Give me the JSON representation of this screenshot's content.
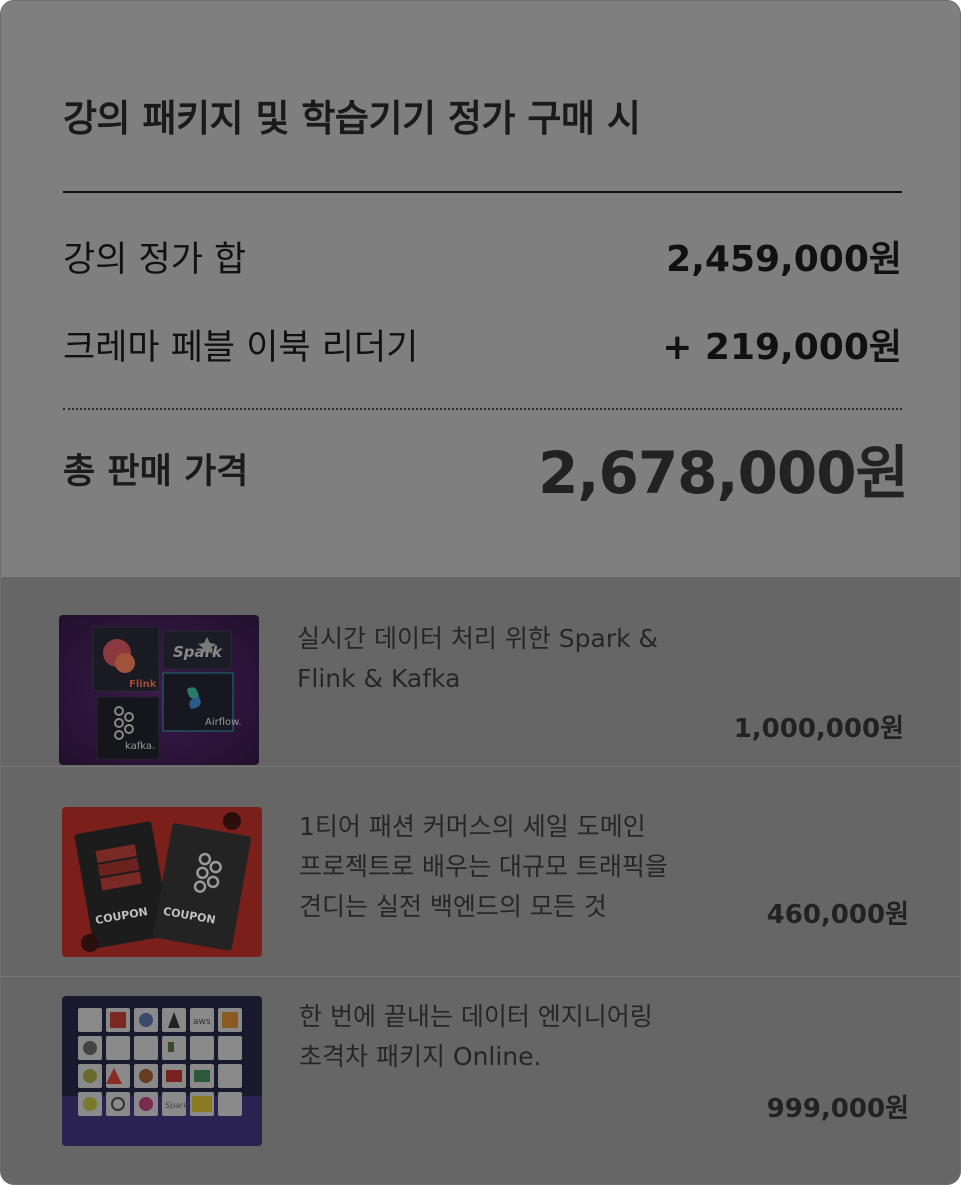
{
  "summary": {
    "title": "강의 패키지 및 학습기기 정가 구매 시",
    "course_total_label": "강의 정가 합",
    "course_total_value": "2,459,000원",
    "device_label": "크레마 페블 이북 리더기",
    "device_value": "+ 219,000원",
    "final_label": "총 판매 가격",
    "final_value": "2,678,000원"
  },
  "items": [
    {
      "title": "실시간 데이터 처리 위한 Spark & Flink & Kafka",
      "price": "1,000,000원",
      "thumbnail_labels": [
        "Flink",
        "Spark",
        "kafka.",
        "Airflow."
      ]
    },
    {
      "title": "1티어 패션 커머스의 세일 도메인 프로젝트로 배우는 대규모 트래픽을 견디는 실전 백엔드의 모든 것",
      "price": "460,000원",
      "thumbnail_labels": [
        "COUPON",
        "COUPON"
      ]
    },
    {
      "title": "한 번에 끝내는 데이터 엔지니어링 초격차 패키지 Online.",
      "price": "999,000원",
      "thumbnail_labels": [
        "aws",
        "Spark"
      ]
    }
  ],
  "colors": {
    "overlay_top": "#7f7f7f",
    "overlay_bottom": "#666666",
    "text_dark": "#111111"
  }
}
